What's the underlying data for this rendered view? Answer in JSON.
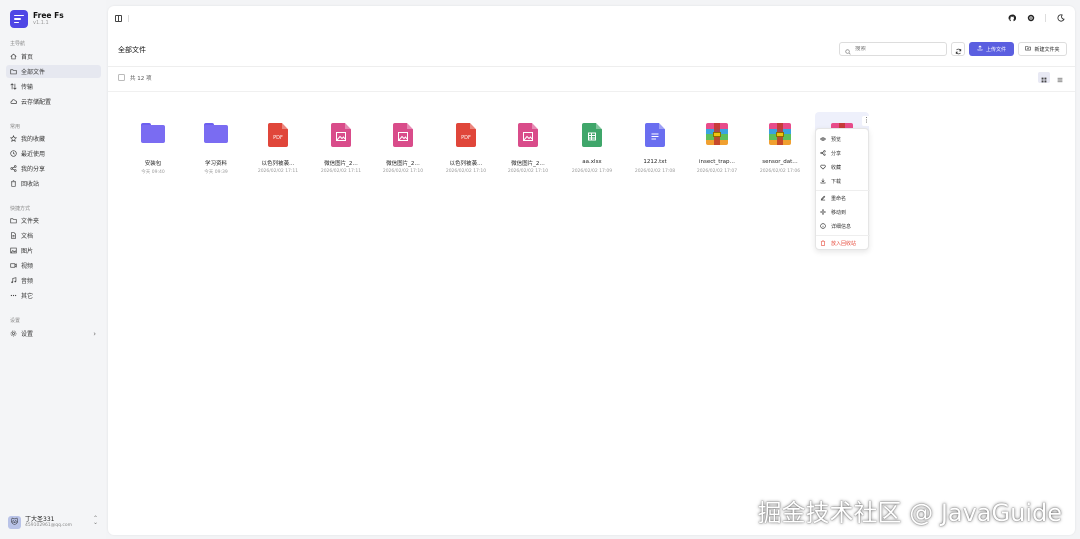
{
  "app": {
    "name": "Free Fs",
    "version": "v1.1.1"
  },
  "sidebar": {
    "sections": [
      {
        "title": "主导航",
        "items": [
          {
            "label": "首页",
            "icon": "home-icon"
          },
          {
            "label": "全部文件",
            "icon": "folder-icon",
            "active": true
          },
          {
            "label": "传输",
            "icon": "transfer-icon"
          },
          {
            "label": "云存储配置",
            "icon": "cloud-icon"
          }
        ]
      },
      {
        "title": "常用",
        "items": [
          {
            "label": "我的收藏",
            "icon": "star-icon"
          },
          {
            "label": "最近使用",
            "icon": "clock-icon"
          },
          {
            "label": "我的分享",
            "icon": "share-icon"
          },
          {
            "label": "回收站",
            "icon": "trash-icon"
          }
        ]
      },
      {
        "title": "快捷方式",
        "items": [
          {
            "label": "文件夹",
            "icon": "folder-icon"
          },
          {
            "label": "文档",
            "icon": "document-icon"
          },
          {
            "label": "图片",
            "icon": "image-icon"
          },
          {
            "label": "视频",
            "icon": "video-icon"
          },
          {
            "label": "音频",
            "icon": "music-icon"
          },
          {
            "label": "其它",
            "icon": "more-icon"
          }
        ]
      },
      {
        "title": "设置",
        "items": [
          {
            "label": "设置",
            "icon": "gear-icon",
            "chevron": "›"
          }
        ]
      }
    ],
    "user": {
      "name": "丁大圣331",
      "email": "459102961@qq.com",
      "avatar": "🐱"
    }
  },
  "header": {
    "page_title": "全部文件",
    "search_placeholder": "搜索",
    "upload_label": "上传文件",
    "new_folder_label": "新建文件夹",
    "count_label": "共 12 项"
  },
  "files": [
    {
      "name": "安装包",
      "date": "今天 09:40",
      "type": "folder"
    },
    {
      "name": "学习资料",
      "date": "今天 09:39",
      "type": "folder"
    },
    {
      "name": "以色列被袭…",
      "date": "2026/02/02 17:11",
      "type": "pdf"
    },
    {
      "name": "微信图片_2…",
      "date": "2026/02/02 17:11",
      "type": "image"
    },
    {
      "name": "微信图片_2…",
      "date": "2026/02/02 17:10",
      "type": "image"
    },
    {
      "name": "以色列被袭…",
      "date": "2026/02/02 17:10",
      "type": "pdf"
    },
    {
      "name": "微信图片_2…",
      "date": "2026/02/02 17:10",
      "type": "image"
    },
    {
      "name": "aa.xlsx",
      "date": "2026/02/02 17:09",
      "type": "sheet"
    },
    {
      "name": "1212.txt",
      "date": "2026/02/02 17:08",
      "type": "text"
    },
    {
      "name": "insect_trap…",
      "date": "2026/02/02 17:07",
      "type": "zip"
    },
    {
      "name": "sensor_dat…",
      "date": "2026/02/02 17:06",
      "type": "zip"
    },
    {
      "name": "",
      "date": "",
      "type": "zip"
    }
  ],
  "file_type_labels": {
    "pdf": "PDF"
  },
  "context_menu": {
    "items": [
      {
        "label": "预览",
        "icon": "eye-icon"
      },
      {
        "label": "分享",
        "icon": "share-icon"
      },
      {
        "label": "收藏",
        "icon": "heart-icon"
      },
      {
        "label": "下载",
        "icon": "download-icon"
      },
      {
        "label": "重命名",
        "icon": "edit-icon"
      },
      {
        "label": "移动到",
        "icon": "move-icon"
      },
      {
        "label": "详细信息",
        "icon": "info-icon"
      },
      {
        "label": "放入回收站",
        "icon": "trash-icon",
        "danger": true
      }
    ]
  },
  "colors": {
    "accent": "#5b5fe0",
    "folder": "#7a6cf2",
    "pdf": "#e0463a",
    "image": "#d94c8a",
    "sheet": "#3fa66a",
    "text": "#6a6ef0",
    "danger": "#e74c3c"
  },
  "watermark": "掘金技术社区 @ JavaGuide"
}
